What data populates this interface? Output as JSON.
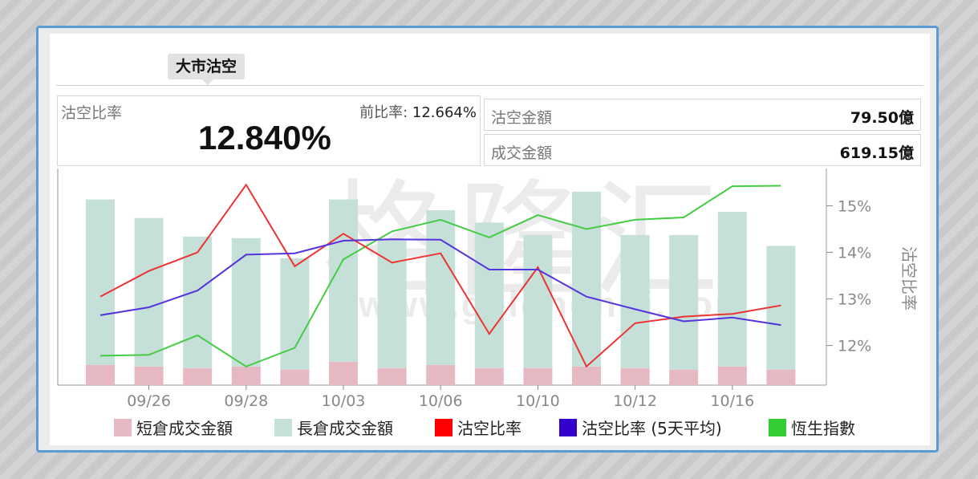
{
  "tab": {
    "label": "大市沽空"
  },
  "summary": {
    "ratio_label": "沽空比率",
    "ratio_value": "12.840%",
    "prev_label": "前比率:",
    "prev_value": "12.664%",
    "short_label": "沽空金額",
    "short_value": "79.50億",
    "turnover_label": "成交金額",
    "turnover_value": "619.15億"
  },
  "watermark": {
    "cn": "格隆汇",
    "url": "www.gelonghui.com"
  },
  "chart_data": {
    "type": "bar",
    "x_ticks": [
      "09/26",
      "09/28",
      "10/03",
      "10/06",
      "10/10",
      "10/12",
      "10/16"
    ],
    "y_right_ticks": [
      "12%",
      "13%",
      "14%",
      "15%"
    ],
    "y_right_label": "沽空比率",
    "y_ratio_range": [
      11.15,
      15.8
    ],
    "series": [
      {
        "name": "短倉成交金額",
        "color": "#e6b8c2",
        "values": [
          1.3,
          1.2,
          1.1,
          1.2,
          1.0,
          1.5,
          1.1,
          1.3,
          1.1,
          1.1,
          1.2,
          1.1,
          1.0,
          1.2,
          1.0
        ]
      },
      {
        "name": "長倉成交金額",
        "color": "#c5e0d8",
        "values": [
          10.7,
          9.6,
          8.5,
          8.3,
          7.2,
          10.5,
          8.3,
          10.0,
          9.4,
          8.6,
          11.3,
          8.6,
          8.7,
          10.0,
          8.0
        ]
      },
      {
        "name": "沽空比率",
        "color": "#ee3333",
        "values": [
          13.05,
          13.6,
          14.0,
          15.45,
          13.7,
          14.4,
          13.78,
          13.98,
          12.25,
          13.68,
          11.55,
          12.48,
          12.62,
          12.68,
          12.86
        ]
      },
      {
        "name": "沽空比率 (5天平均)",
        "color": "#5533dd",
        "values": [
          12.65,
          12.82,
          13.18,
          13.95,
          13.98,
          14.25,
          14.28,
          14.27,
          13.63,
          13.63,
          13.05,
          12.78,
          12.52,
          12.6,
          12.44
        ]
      },
      {
        "name": "恆生指數",
        "color": "#44cc44",
        "values": [
          11.78,
          11.8,
          12.22,
          11.55,
          11.95,
          13.85,
          14.45,
          14.7,
          14.32,
          14.8,
          14.5,
          14.7,
          14.75,
          15.42,
          15.43
        ]
      }
    ],
    "legend": [
      "短倉成交金額",
      "長倉成交金額",
      "沽空比率",
      "沽空比率 (5天平均)",
      "恆生指數"
    ],
    "legend_colors": [
      "#e6b8c2",
      "#c5e0d8",
      "#ff0000",
      "#3300cc",
      "#33cc33"
    ],
    "legend_position": "bottom"
  }
}
